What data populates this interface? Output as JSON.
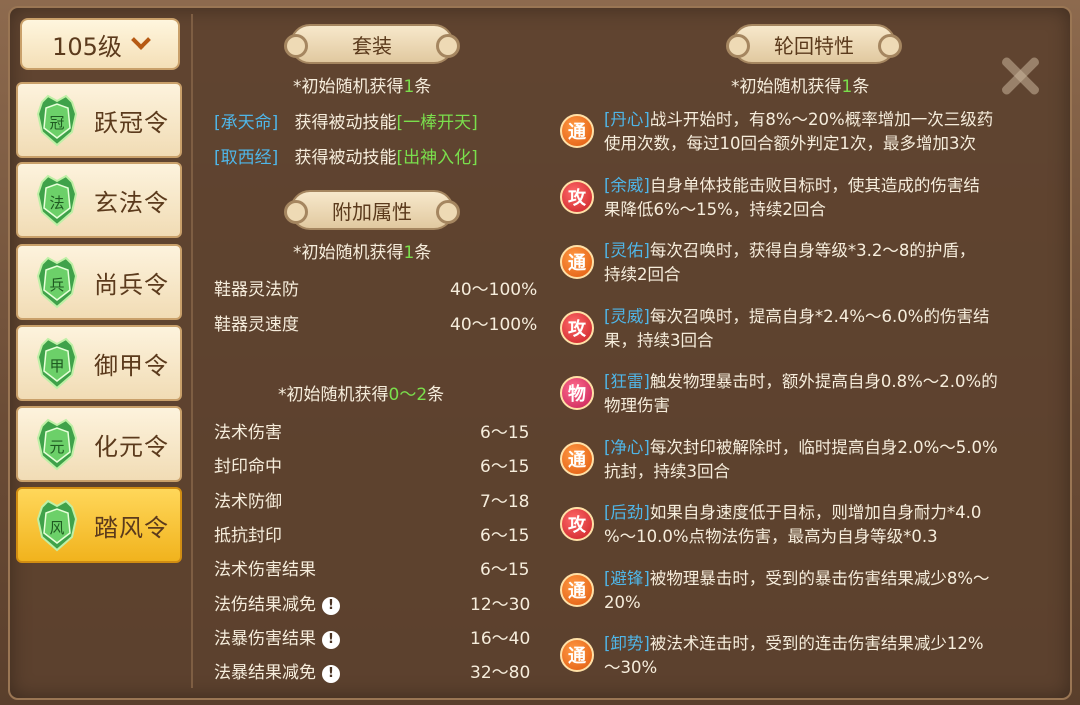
{
  "level_selector": {
    "label": "105级"
  },
  "nav": [
    {
      "char": "冠",
      "label": "跃冠令",
      "active": false
    },
    {
      "char": "法",
      "label": "玄法令",
      "active": false
    },
    {
      "char": "兵",
      "label": "尚兵令",
      "active": false
    },
    {
      "char": "甲",
      "label": "御甲令",
      "active": false
    },
    {
      "char": "元",
      "label": "化元令",
      "active": false
    },
    {
      "char": "风",
      "label": "踏风令",
      "active": true
    }
  ],
  "set_section": {
    "title": "套装",
    "note_prefix": "*初始随机获得",
    "note_num": "1",
    "note_suffix": "条",
    "rows": [
      {
        "name": "[承天命]",
        "text": "获得被动技能",
        "skill": "[一棒开天]"
      },
      {
        "name": "[取西经]",
        "text": "获得被动技能",
        "skill": "[出神入化]"
      }
    ]
  },
  "attr_section": {
    "title": "附加属性",
    "note_prefix": "*初始随机获得",
    "note_num": "1",
    "note_suffix": "条",
    "rows": [
      {
        "label": "鞋器灵法防",
        "value": "40～100%"
      },
      {
        "label": "鞋器灵速度",
        "value": "40～100%"
      }
    ],
    "note2_prefix": "*初始随机获得",
    "note2_num": "0～2",
    "note2_suffix": "条",
    "rows2": [
      {
        "label": "法术伤害",
        "value": "6～15",
        "warn": false
      },
      {
        "label": "封印命中",
        "value": "6～15",
        "warn": false
      },
      {
        "label": "法术防御",
        "value": "7～18",
        "warn": false
      },
      {
        "label": "抵抗封印",
        "value": "6～15",
        "warn": false
      },
      {
        "label": "法术伤害结果",
        "value": "6～15",
        "warn": false
      },
      {
        "label": "法伤结果减免",
        "value": "12～30",
        "warn": true
      },
      {
        "label": "法暴伤害结果",
        "value": "16～40",
        "warn": true
      },
      {
        "label": "法暴结果减免",
        "value": "32～80",
        "warn": true
      }
    ]
  },
  "trait_section": {
    "title": "轮回特性",
    "note_prefix": "*初始随机获得",
    "note_num": "1",
    "note_suffix": "条",
    "items": [
      {
        "badge": "通",
        "type": "tong",
        "name": "[丹心]",
        "line1": "战斗开始时，有8%～20%概率增加一次三级药",
        "line2": "使用次数，每过10回合额外判定1次，最多增加3次"
      },
      {
        "badge": "攻",
        "type": "gong",
        "name": "[余威]",
        "line1": "自身单体技能击败目标时，使其造成的伤害结",
        "line2": "果降低6%～15%，持续2回合"
      },
      {
        "badge": "通",
        "type": "tong",
        "name": "[灵佑]",
        "line1": "每次召唤时，获得自身等级*3.2～8的护盾，",
        "line2": "持续2回合"
      },
      {
        "badge": "攻",
        "type": "gong",
        "name": "[灵威]",
        "line1": "每次召唤时，提高自身*2.4%～6.0%的伤害结",
        "line2": "果，持续3回合"
      },
      {
        "badge": "物",
        "type": "wu",
        "name": "[狂雷]",
        "line1": "触发物理暴击时，额外提高自身0.8%～2.0%的",
        "line2": "物理伤害"
      },
      {
        "badge": "通",
        "type": "tong",
        "name": "[净心]",
        "line1": "每次封印被解除时，临时提高自身2.0%～5.0%",
        "line2": "抗封，持续3回合"
      },
      {
        "badge": "攻",
        "type": "gong",
        "name": "[后劲]",
        "line1": "如果自身速度低于目标，则增加自身耐力*4.0",
        "line2": "%～10.0%点物法伤害，最高为自身等级*0.3"
      },
      {
        "badge": "通",
        "type": "tong",
        "name": "[避锋]",
        "line1": "被物理暴击时，受到的暴击伤害结果减少8%～",
        "line2": "20%"
      },
      {
        "badge": "通",
        "type": "tong",
        "name": "[卸势]",
        "line1": "被法术连击时，受到的连击伤害结果减少12%",
        "line2": "～30%"
      }
    ]
  },
  "colors": {
    "accent_green": "#7adf4c",
    "accent_blue": "#4fb6e8",
    "active_tab": "#f1b31d"
  }
}
